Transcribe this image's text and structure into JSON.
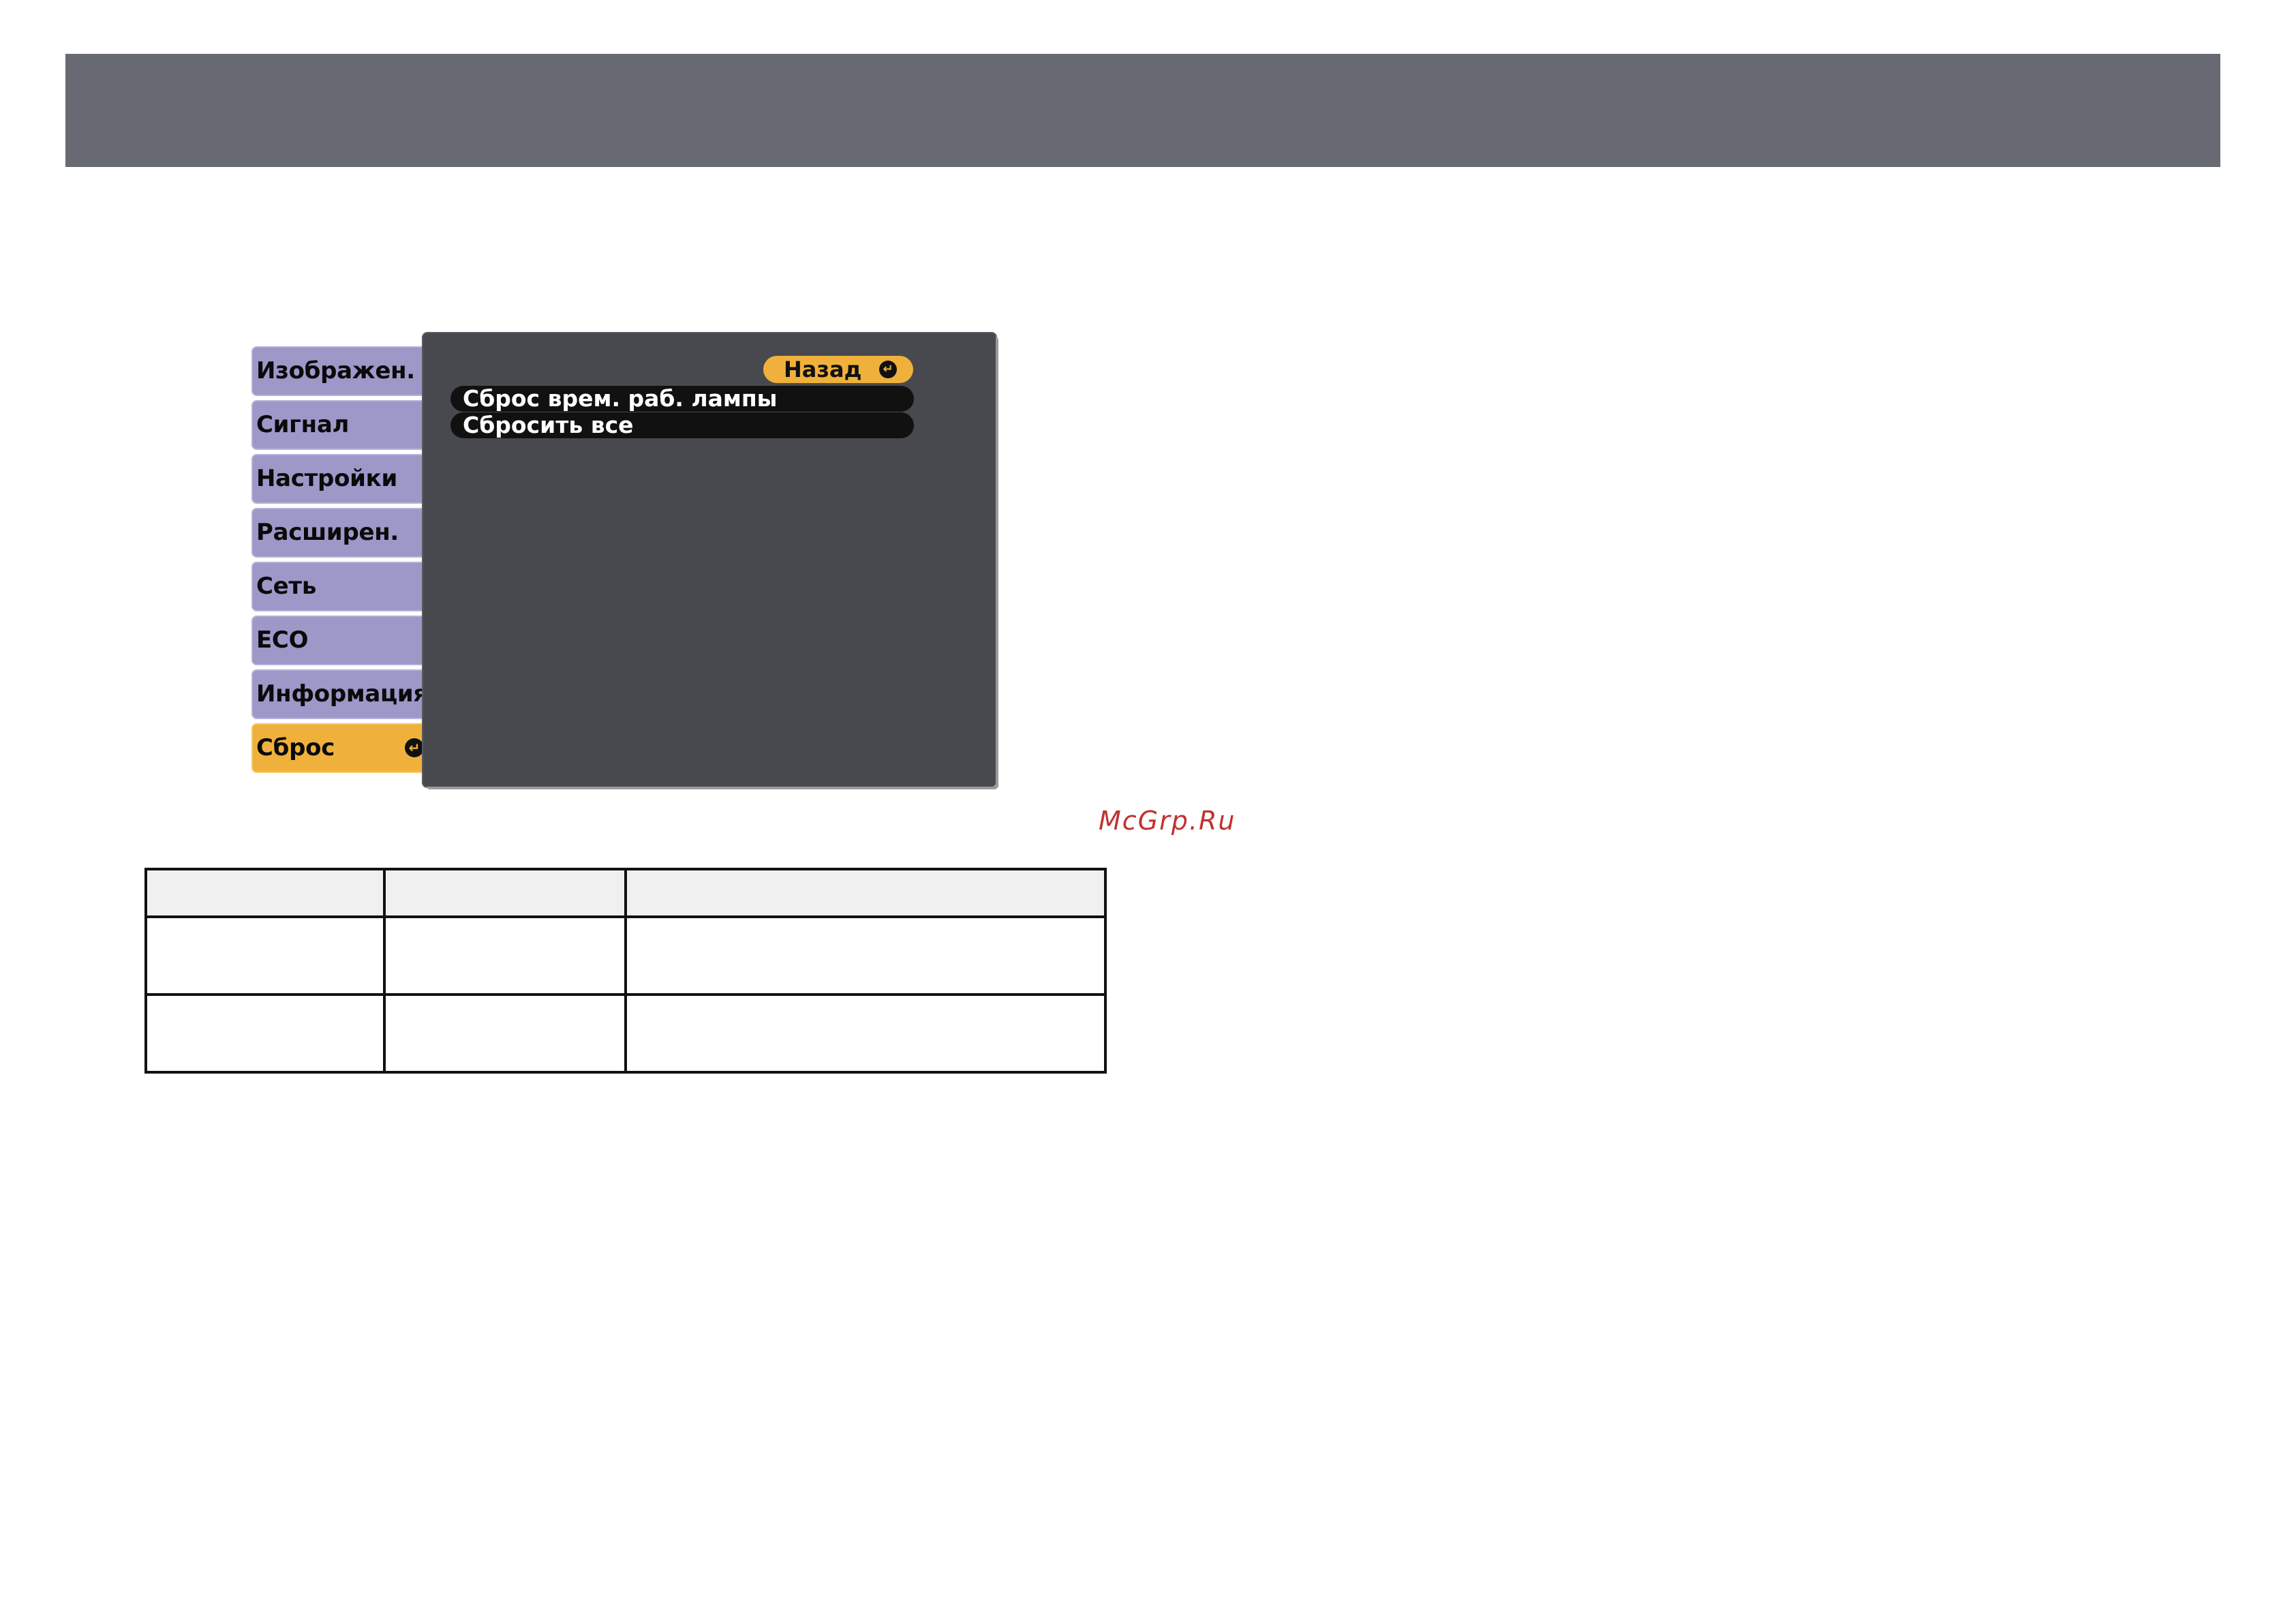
{
  "tabs": [
    {
      "label": "Изображен.",
      "active": false
    },
    {
      "label": "Сигнал",
      "active": false
    },
    {
      "label": "Настройки",
      "active": false
    },
    {
      "label": "Расширен.",
      "active": false
    },
    {
      "label": "Сеть",
      "active": false
    },
    {
      "label": "ECO",
      "active": false
    },
    {
      "label": "Информация",
      "active": false
    },
    {
      "label": "Сброс",
      "active": true
    }
  ],
  "panel": {
    "back_label": "Назад",
    "items": [
      {
        "label": "Сброс врем. раб. лампы"
      },
      {
        "label": "Сбросить все"
      }
    ]
  },
  "watermark": "McGrp.Ru",
  "table": {
    "columns": [
      "",
      "",
      ""
    ],
    "rows": [
      [
        "",
        "",
        ""
      ],
      [
        "",
        "",
        ""
      ]
    ]
  },
  "colors": {
    "header_bar": "#676a72",
    "tab_inactive": "#9d98c8",
    "tab_active": "#f0b13c",
    "panel_bg": "#48494e"
  }
}
